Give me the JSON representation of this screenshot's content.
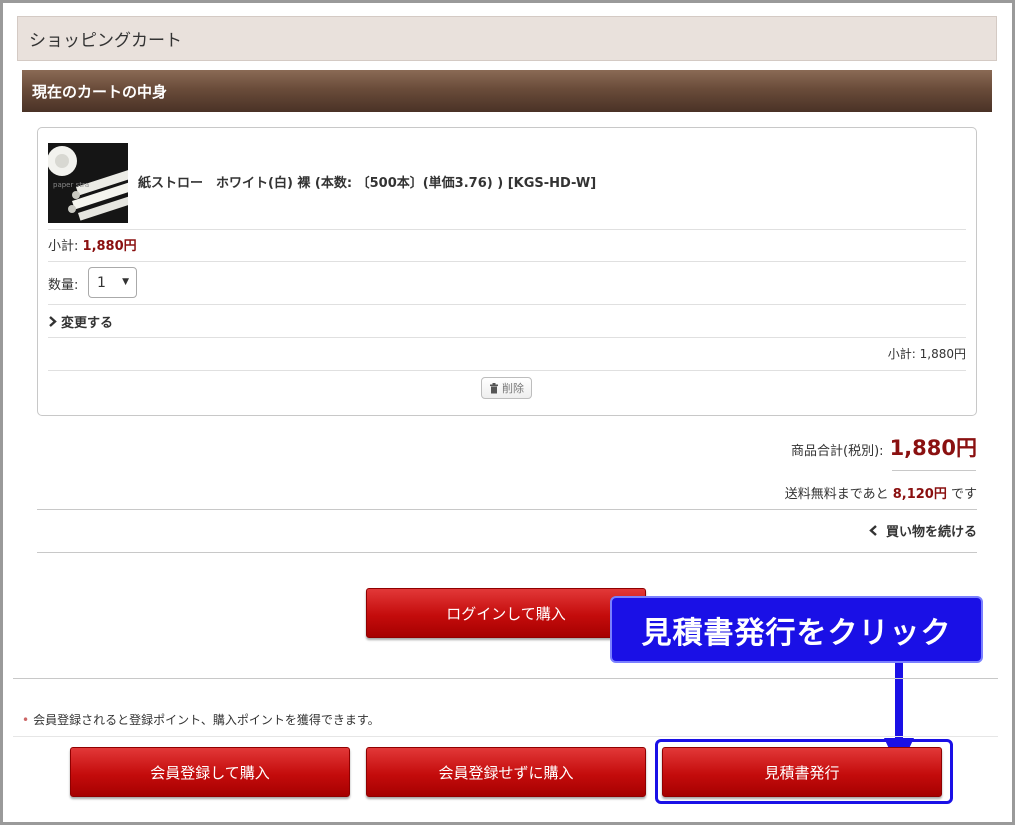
{
  "header": {
    "title": "ショッピングカート"
  },
  "cart": {
    "heading": "現在のカートの中身",
    "item": {
      "name": "紙ストロー　ホワイト(白) 裸 (本数: 〔500本〕(単価3.76) ) [KGS-HD-W]",
      "thumb_icon": "paper-straw-product-photo",
      "thumb_text": "paper stra",
      "subtotal_label": "小計:",
      "subtotal_value": "1,880円",
      "quantity_label": "数量:",
      "quantity_value": "1",
      "change_label": "変更する",
      "subtotal_right": "小計: 1,880円",
      "delete_label": "削除"
    }
  },
  "summary": {
    "total_label": "商品合計(税別):",
    "total_value": "1,880円",
    "freeship_prefix": "送料無料まであと",
    "freeship_amount": "8,120円",
    "freeship_suffix": "です",
    "continue_label": "買い物を続ける"
  },
  "actions": {
    "login_buy": "ログインして購入",
    "member_note": "会員登録されると登録ポイント、購入ポイントを獲得できます。",
    "register_buy": "会員登録して購入",
    "guest_buy": "会員登録せずに購入",
    "estimate": "見積書発行"
  },
  "annotation": {
    "callout_text": "見積書発行をクリック",
    "color": "#1a10e6"
  },
  "colors": {
    "accent_red": "#8a1010",
    "button_red": "#c40c0c",
    "header_brown": "#6a4c3a"
  }
}
